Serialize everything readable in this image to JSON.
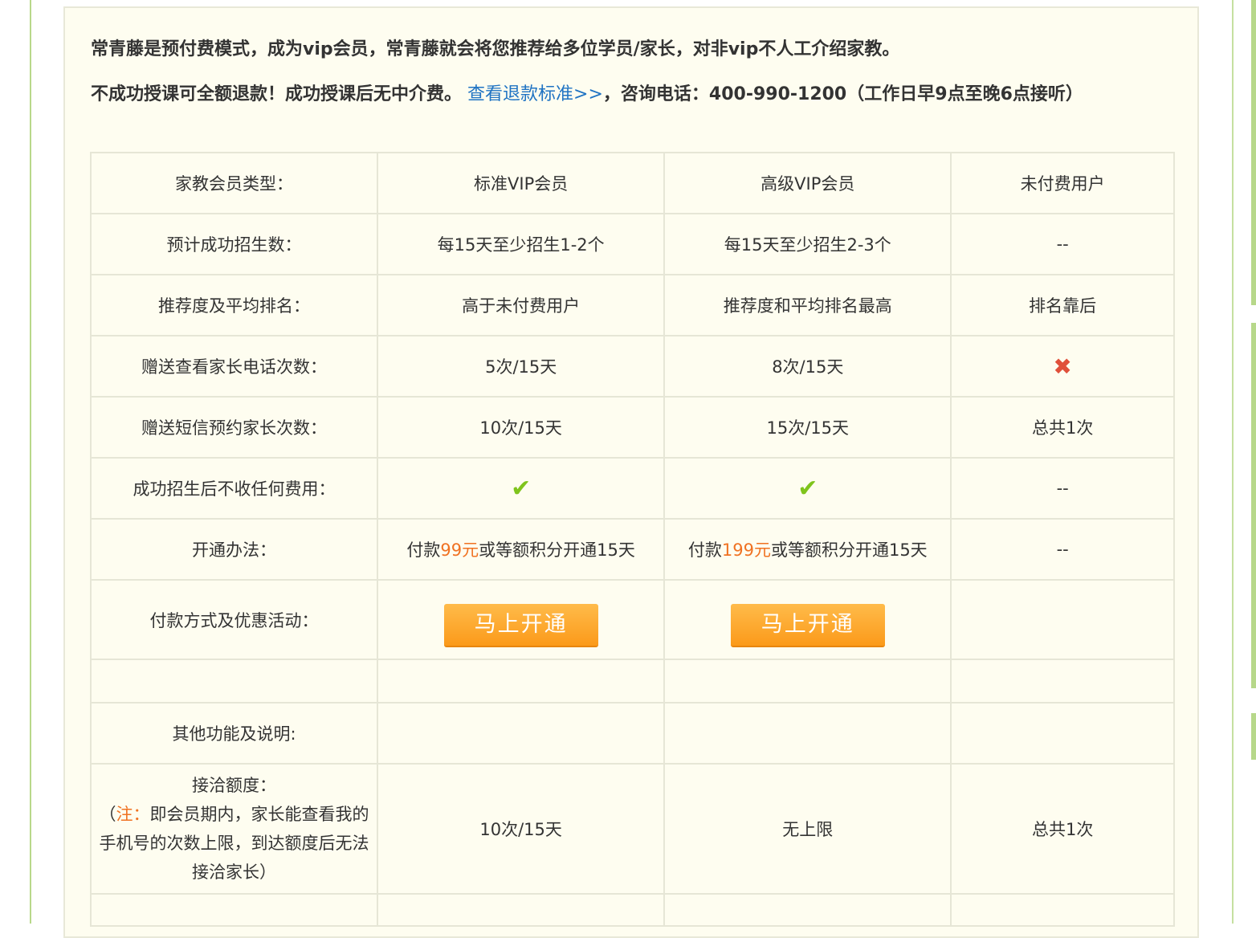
{
  "intro": {
    "line1_part1": "常青藤是预付费模式，成为",
    "line1_vip1": "vip",
    "line1_part2": "会员，常青藤就会将您推荐给多位学员/家长，对非",
    "line1_vip2": "vip",
    "line1_part3": "不人工介绍家教。",
    "line2_part1": "不成功授课可全额退款！成功授课后无中介费。",
    "refund_link": "查看退款标准>>",
    "line2_part2": "，咨询电话：",
    "phone": "400-990-1200",
    "line2_part3": "（工作日早",
    "hour_start": "9",
    "line2_part4": "点至晚",
    "hour_end": "6",
    "line2_part5": "点接听）"
  },
  "table": {
    "header": {
      "label": "家教会员类型：",
      "col1": "标准VIP会员",
      "col2": "高级VIP会员",
      "col3": "未付费用户"
    },
    "row_enroll": {
      "label": "预计成功招生数：",
      "col1": "每15天至少招生1-2个",
      "col2": "每15天至少招生2-3个",
      "col3": "--"
    },
    "row_rank": {
      "label": "推荐度及平均排名：",
      "col1": "高于未付费用户",
      "col2": "推荐度和平均排名最高",
      "col3": "排名靠后"
    },
    "row_phone_views": {
      "label": "赠送查看家长电话次数：",
      "col1": "5次/15天",
      "col2": "8次/15天",
      "col3_icon": "cross-icon"
    },
    "row_sms": {
      "label": "赠送短信预约家长次数：",
      "col1": "10次/15天",
      "col2": "15次/15天",
      "col3": "总共1次"
    },
    "row_nofee": {
      "label": "成功招生后不收任何费用：",
      "col1_icon": "check-icon",
      "col2_icon": "check-icon",
      "col3": "--"
    },
    "row_open": {
      "label": "开通办法：",
      "col1_pre": "付款",
      "col1_price": "99元",
      "col1_post": "或等额积分开通15天",
      "col2_pre": "付款",
      "col2_price": "199元",
      "col2_post": "或等额积分开通15天",
      "col3": "--"
    },
    "row_pay": {
      "label": "付款方式及优惠活动：",
      "btn1": "马上开通",
      "btn2": "马上开通"
    },
    "row_other": {
      "label": "其他功能及说明:"
    },
    "row_quota": {
      "label_title": "接洽额度：",
      "note_open": "（",
      "note_prefix": "注：",
      "note_text": "即会员期内，家长能查看我的手机号的次数上限，到达额度后无法接洽家长）",
      "col1": "10次/15天",
      "col2": "无上限",
      "col3": "总共1次"
    }
  },
  "colors": {
    "orange": "#f07222",
    "red": "#e31c1c",
    "link": "#1f73c3",
    "panel_bg": "#fefdf0",
    "check": "#7fc41c",
    "cross": "#e0503a"
  }
}
